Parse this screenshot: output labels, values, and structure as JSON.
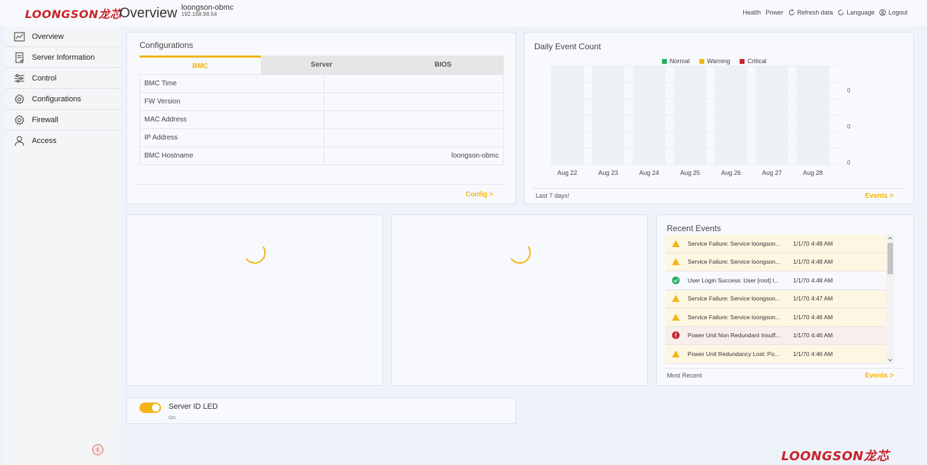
{
  "header": {
    "logo": "LOONGSON龙芯",
    "title": "Overview",
    "hostname": "loongson-obmc",
    "ip": "192.168.98.54",
    "actions": [
      {
        "label": "Health",
        "icon": ""
      },
      {
        "label": "Power",
        "icon": ""
      },
      {
        "label": "Refresh data",
        "icon": "refresh-icon"
      },
      {
        "label": "Language",
        "icon": "language-icon"
      },
      {
        "label": "Logout",
        "icon": "logout-icon"
      }
    ]
  },
  "sidebar": {
    "items": [
      {
        "label": "Overview",
        "icon": "chart-line-icon"
      },
      {
        "label": "Server Information",
        "icon": "server-info-icon"
      },
      {
        "label": "Control",
        "icon": "sliders-icon"
      },
      {
        "label": "Configurations",
        "icon": "gear-icon"
      },
      {
        "label": "Firewall",
        "icon": "gear-icon"
      },
      {
        "label": "Access",
        "icon": "user-icon"
      }
    ],
    "collapse_icon": "chevron-left-icon"
  },
  "configurations": {
    "title": "Configurations",
    "tabs": [
      "BMC",
      "Server",
      "BIOS"
    ],
    "active_tab": "BMC",
    "rows": [
      {
        "label": "BMC Time",
        "value": ""
      },
      {
        "label": "FW Version",
        "value": ""
      },
      {
        "label": "MAC Address",
        "value": ""
      },
      {
        "label": "IP Address",
        "value": ""
      },
      {
        "label": "BMC Hostname",
        "value": "loongson-obmc"
      }
    ],
    "link": "Config >"
  },
  "daily_events": {
    "title": "Daily Event Count",
    "footer": "Last 7 days!",
    "link": "Events >",
    "chart_data": {
      "type": "bar",
      "categories": [
        "Aug 22",
        "Aug 23",
        "Aug 24",
        "Aug 25",
        "Aug 26",
        "Aug 27",
        "Aug 28"
      ],
      "series": [
        {
          "name": "Normal",
          "color": "#27ae60",
          "values": [
            0,
            0,
            0,
            0,
            0,
            0,
            0
          ]
        },
        {
          "name": "Warning",
          "color": "#f3b414",
          "values": [
            0,
            0,
            0,
            0,
            0,
            0,
            0
          ]
        },
        {
          "name": "Critical",
          "color": "#c0282e",
          "values": [
            0,
            0,
            0,
            0,
            0,
            0,
            0
          ]
        }
      ],
      "yticks": [
        "0",
        "0",
        "0"
      ],
      "legend_position": "top"
    }
  },
  "recent_events": {
    "title": "Recent Events",
    "footer": "Most Recent",
    "link": "Events >",
    "items": [
      {
        "severity": "warning",
        "icon": "warning-icon",
        "text": "Service Failure: Service loongson...",
        "time": "1/1/70 4:49 AM"
      },
      {
        "severity": "warning",
        "icon": "warning-icon",
        "text": "Service Failure: Service loongson...",
        "time": "1/1/70 4:48 AM"
      },
      {
        "severity": "ok",
        "icon": "check-circle-icon",
        "text": "User Login Success: User [root] l...",
        "time": "1/1/70 4:48 AM"
      },
      {
        "severity": "warning",
        "icon": "warning-icon",
        "text": "Service Failure: Service loongson...",
        "time": "1/1/70 4:47 AM"
      },
      {
        "severity": "warning",
        "icon": "warning-icon",
        "text": "Service Failure: Service loongson...",
        "time": "1/1/70 4:46 AM"
      },
      {
        "severity": "critical",
        "icon": "error-icon",
        "text": "Power Unit Non Redundant Insuff...",
        "time": "1/1/70 4:46 AM"
      },
      {
        "severity": "warning",
        "icon": "warning-icon",
        "text": "Power Unit Redundancy Lost: Po...",
        "time": "1/1/70 4:46 AM"
      }
    ]
  },
  "led": {
    "title": "Server ID LED",
    "state": "On"
  },
  "footer_logo": "LOONGSON龙芯",
  "colors": {
    "accent": "#f3b414",
    "brand": "#c9242b",
    "bar_bg": "#eef1f4"
  }
}
